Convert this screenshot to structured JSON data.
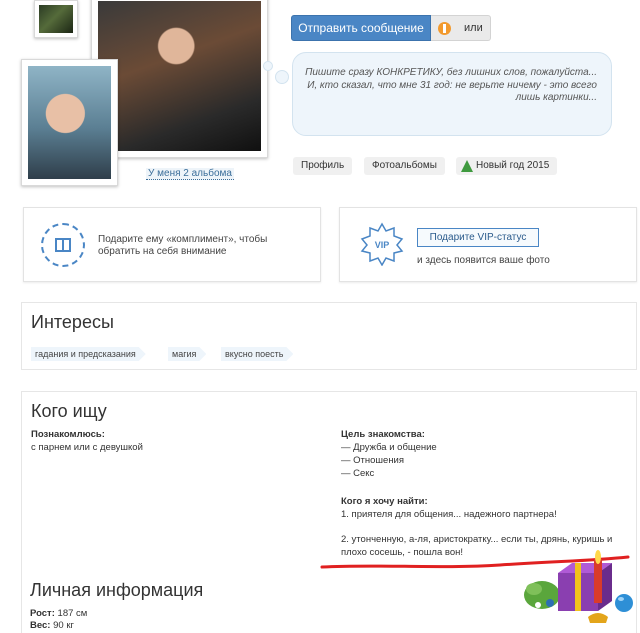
{
  "profile": {
    "albums_link": "У меня 2 альбома"
  },
  "actions": {
    "send_message": "Отправить сообщение",
    "or_label": "или"
  },
  "status_bubble": {
    "text": "Пишите сразу КОНКРЕТИКУ, без лишних слов, пожалуйста... И, кто сказал, что мне 31 год: не верьте ничему - это всего лишь картинки..."
  },
  "tabs": [
    {
      "label": "Профиль"
    },
    {
      "label": "Фотоальбомы"
    },
    {
      "label": "Новый год 2015"
    }
  ],
  "compliment_card": {
    "text": "Подарите ему «комплимент», чтобы обратить на себя внимание"
  },
  "vip_card": {
    "badge": "VIP",
    "button": "Подарите VIP-статус",
    "text": "и здесь появится ваше фото"
  },
  "interests": {
    "title": "Интересы",
    "tags": [
      "гадания и предсказания",
      "магия",
      "вкусно поесть"
    ]
  },
  "looking_for": {
    "title": "Кого ищу",
    "meet_label": "Познакомлюсь:",
    "meet_value": "с парнем или с девушкой",
    "goal_label": "Цель знакомства:",
    "goals": [
      "— Дружба и общение",
      "— Отношения",
      "— Секс"
    ],
    "whom_label": "Кого я хочу найти:",
    "whom_1": "1. приятеля для общения... надежного партнера!",
    "whom_2": "2. утонченную, а-ля, аристократку... если ты, дрянь, куришь и плохо сосешь, - пошла вон!"
  },
  "personal": {
    "title": "Личная информация",
    "height_label": "Рост:",
    "height_value": "187 см",
    "weight_label": "Вес:",
    "weight_value": "90 кг"
  },
  "colors": {
    "accent": "#4a86c5",
    "underline": "#e02020"
  }
}
